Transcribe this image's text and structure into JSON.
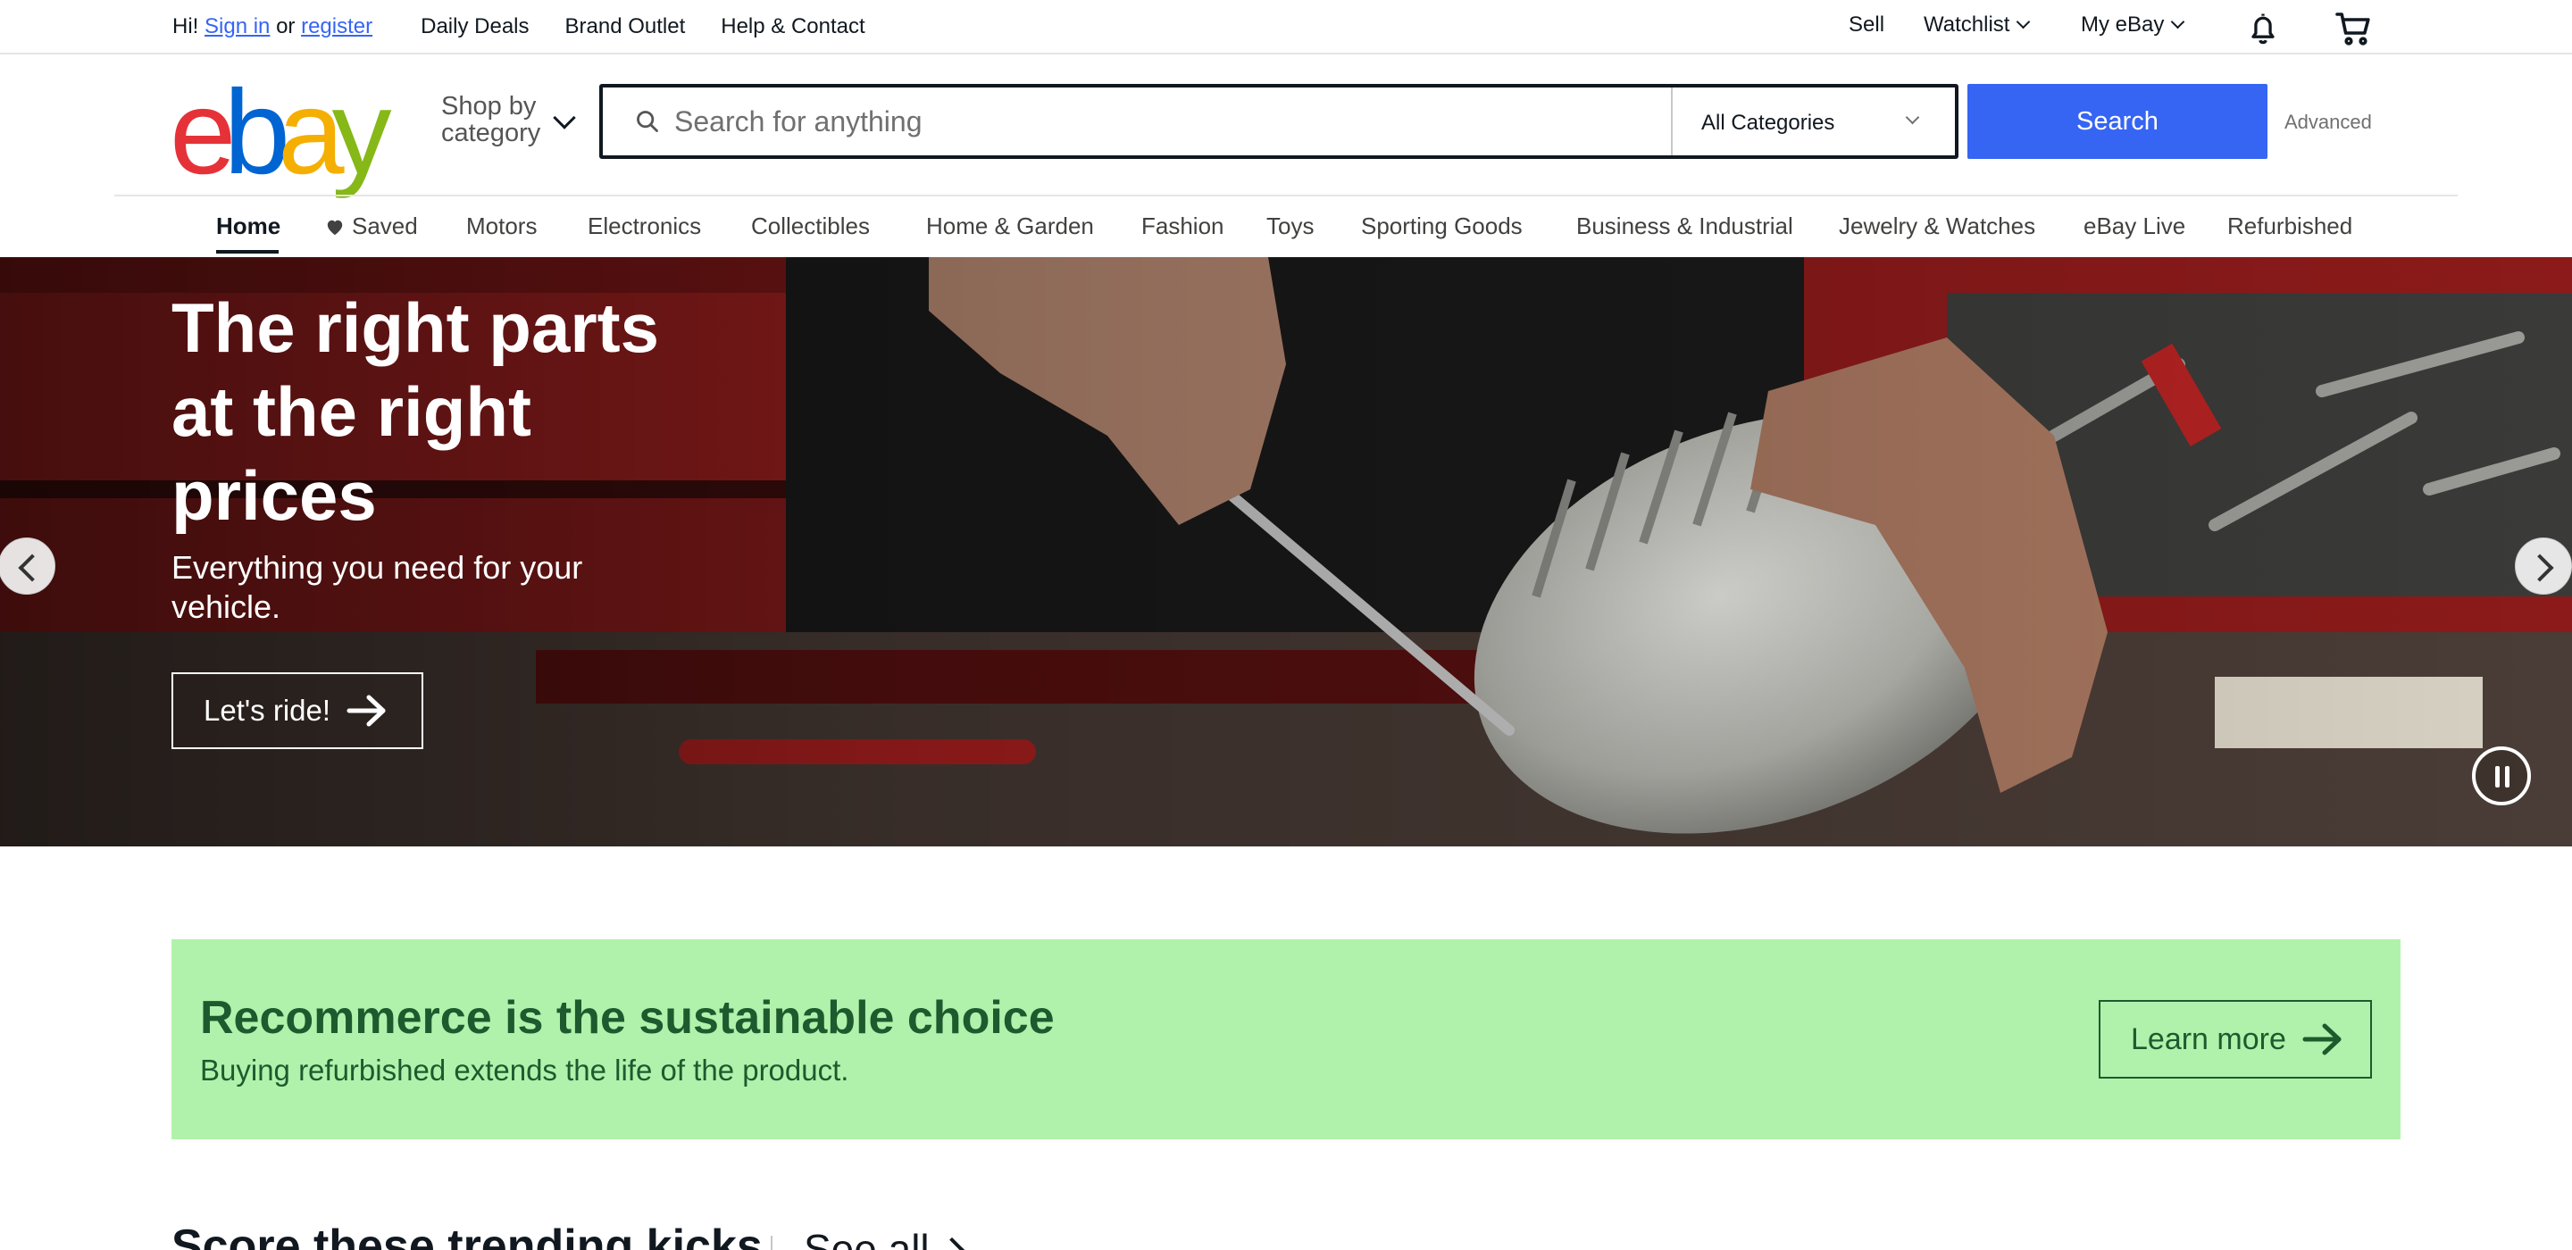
{
  "topbar": {
    "greeting": "Hi!",
    "sign_in": "Sign in",
    "or": "or",
    "register": "register",
    "links": [
      "Daily Deals",
      "Brand Outlet",
      "Help & Contact"
    ],
    "sell": "Sell",
    "watchlist": "Watchlist",
    "my_ebay": "My eBay",
    "notification_icon": "bell-icon",
    "cart_icon": "cart-icon"
  },
  "header": {
    "logo": {
      "letters": [
        "e",
        "b",
        "a",
        "y"
      ],
      "colors": [
        "#e53238",
        "#0064d2",
        "#f5af02",
        "#86b817"
      ]
    },
    "shop_by_line1": "Shop by",
    "shop_by_line2": "category",
    "search_placeholder": "Search for anything",
    "category_select": "All Categories",
    "search_button": "Search",
    "advanced": "Advanced",
    "search_button_color": "#3665f3"
  },
  "nav": {
    "tabs": [
      "Home",
      "Saved",
      "Motors",
      "Electronics",
      "Collectibles",
      "Home & Garden",
      "Fashion",
      "Toys",
      "Sporting Goods",
      "Business & Industrial",
      "Jewelry & Watches",
      "eBay Live",
      "Refurbished"
    ],
    "active": "Home"
  },
  "hero": {
    "title": "The right parts at the right prices",
    "subtitle": "Everything you need for your vehicle.",
    "cta": "Let's ride!"
  },
  "banner": {
    "title": "Recommerce is the sustainable choice",
    "subtitle": "Buying refurbished extends the life of the product.",
    "cta": "Learn more",
    "background": "#b0f2ab",
    "text_color": "#1e5a2e"
  },
  "trending": {
    "title": "Score these trending kicks",
    "see_all": "See all"
  }
}
